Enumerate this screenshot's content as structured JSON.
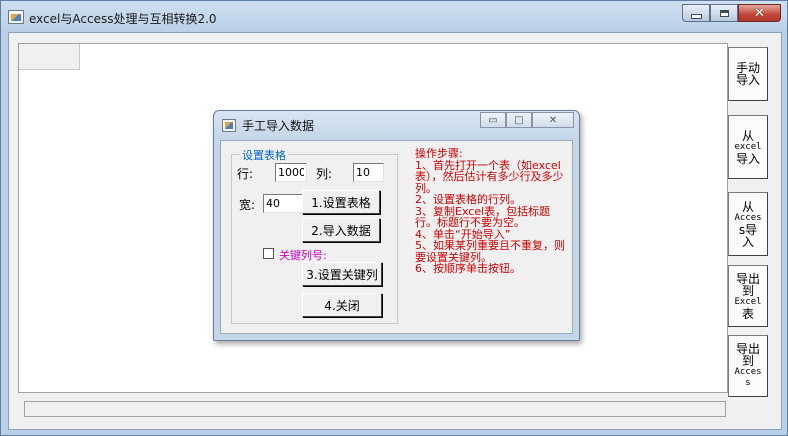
{
  "app": {
    "title": "excel与Access处理与互相转换2.0"
  },
  "side_buttons": {
    "manual_import": "手动导入",
    "from_excel_a": "从",
    "from_excel_b": "excel",
    "from_excel_c": "导入",
    "from_access_a": "从",
    "from_access_b": "Acces",
    "from_access_c": "s导入",
    "export_excel_a": "导出到",
    "export_excel_b": "Excel",
    "export_excel_c": "表",
    "export_access_a": "导出到",
    "export_access_b": "Acces",
    "export_access_c": "s"
  },
  "dialog": {
    "title": "手工导入数据",
    "group_title": "设置表格",
    "row_label": "行:",
    "row_value": "1000",
    "col_label": "列:",
    "col_value": "10",
    "width_label": "宽:",
    "width_value": "40",
    "btn_set_table": "1.设置表格",
    "btn_import": "2.导入数据",
    "key_col_label": "关键列号:",
    "btn_set_key": "3.设置关键列",
    "btn_close": "4.关闭",
    "steps_title": "操作步骤:",
    "steps": [
      "1、首先打开一个表（如excel表），然后估计有多少行及多少列。",
      "2、设置表格的行列。",
      "3、复制Excel表，包括标题行。标题行不要为空。",
      "4、单击“开始导入”",
      "5、如果某列重要且不重复，则要设置关键列。",
      "6、按顺序单击按钮。"
    ]
  }
}
